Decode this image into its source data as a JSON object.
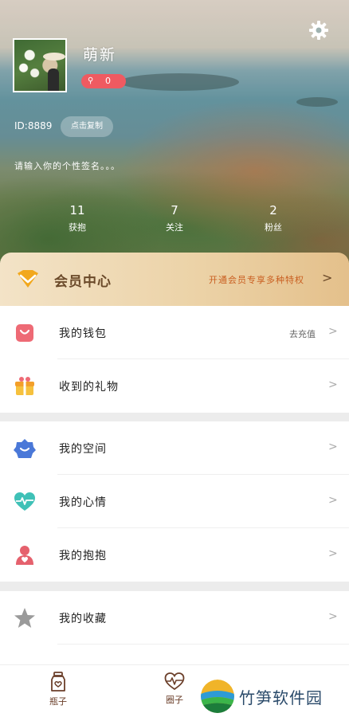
{
  "profile": {
    "nickname": "萌新",
    "level": "0",
    "id_text": "ID:8889",
    "copy_button": "点击复制",
    "signature": "请输入你的个性签名。。。"
  },
  "stats": [
    {
      "value": "11",
      "label": "获抱"
    },
    {
      "value": "7",
      "label": "关注"
    },
    {
      "value": "2",
      "label": "粉丝"
    }
  ],
  "member": {
    "title": "会员中心",
    "promo": "开通会员专享多种特权"
  },
  "menu": {
    "group1": [
      {
        "label": "我的钱包",
        "extra": "去充值",
        "icon": "wallet-bag-icon"
      },
      {
        "label": "收到的礼物",
        "icon": "gift-icon"
      }
    ],
    "group2": [
      {
        "label": "我的空间",
        "icon": "flower-space-icon"
      },
      {
        "label": "我的心情",
        "icon": "heart-pulse-icon"
      },
      {
        "label": "我的抱抱",
        "icon": "hug-person-icon"
      }
    ],
    "group3": [
      {
        "label": "我的收藏",
        "icon": "star-icon"
      }
    ]
  },
  "tabs": [
    {
      "label": "瓶子",
      "icon": "bottle-icon"
    },
    {
      "label": "圈子",
      "icon": "heart-pulse-tab-icon"
    }
  ],
  "watermark": {
    "text": "竹笋软件园"
  },
  "colors": {
    "member_gold": "#e4c08b",
    "promo_orange": "#c95e20",
    "level_red": "#ef5a61",
    "tab_brown": "#6b3f2a"
  }
}
